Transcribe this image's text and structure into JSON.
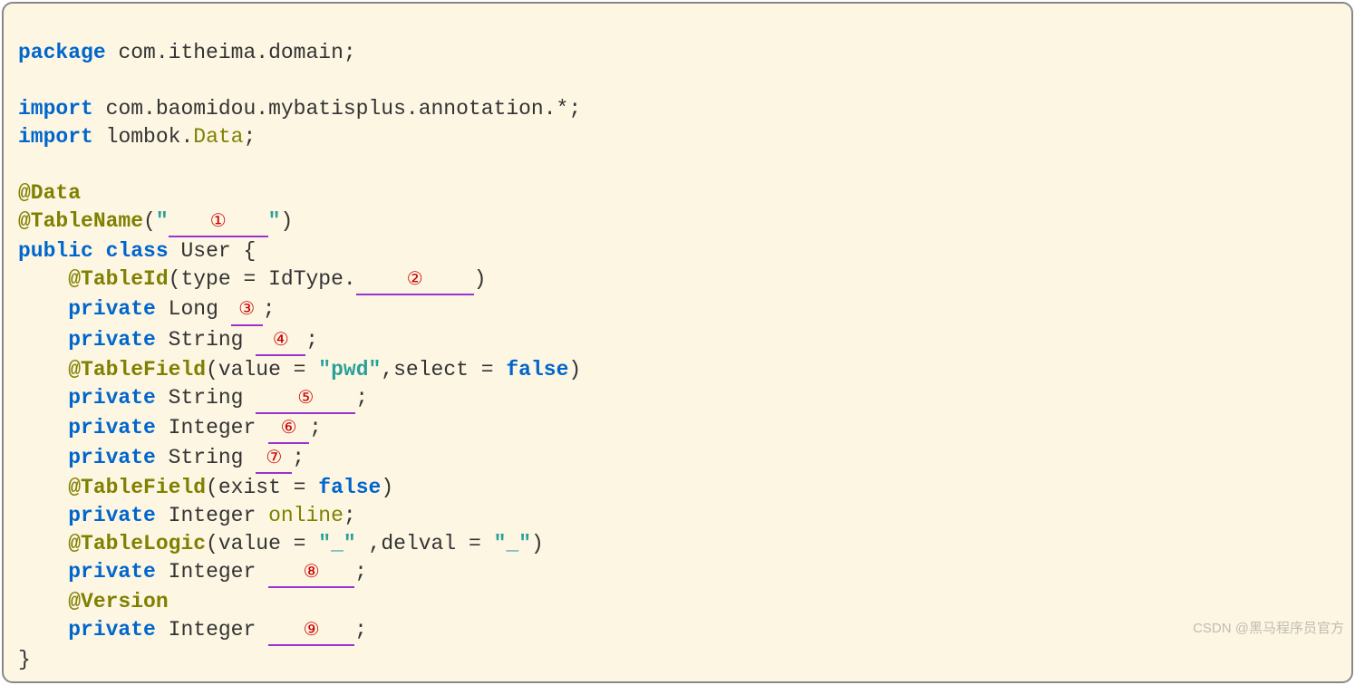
{
  "code": {
    "package_kw": "package",
    "package_name": "com.itheima.domain",
    "import_kw": "import",
    "import1_a": "com.baomidou.mybatisplus.annotation.*",
    "import2_a": "lombok.",
    "import2_b": "Data",
    "ann_data": "@Data",
    "ann_tablename": "@TableName",
    "public_kw": "public",
    "class_kw": "class",
    "class_name": "User",
    "lbrace": "{",
    "rbrace": "}",
    "ann_tableid": "@TableId",
    "type_lbl": "type",
    "eq": " = ",
    "idtype": "IdType",
    "dot": ".",
    "private_kw": "private",
    "t_long": "Long",
    "t_string": "String",
    "t_integer": "Integer",
    "ann_tablefield": "@TableField",
    "value_lbl": "value",
    "str_pwd": "\"pwd\"",
    "select_lbl": "select",
    "false_lit": "false",
    "exist_lbl": "exist",
    "field_online": "online",
    "ann_tablelogic": "@TableLogic",
    "str_under1": "\"_\"",
    "delval_lbl": "delval",
    "str_under2": "\"_\"",
    "ann_version": "@Version",
    "semi": ";",
    "comma": ",",
    "lparen": "(",
    "rparen": ")",
    "quote_open": "\"",
    "quote_close": "\""
  },
  "blanks": {
    "b1": "①",
    "b2": "②",
    "b3": "③",
    "b4": "④",
    "b5": "⑤",
    "b6": "⑥",
    "b7": "⑦",
    "b8": "⑧",
    "b9": "⑨"
  },
  "watermark": "CSDN @黑马程序员官方"
}
